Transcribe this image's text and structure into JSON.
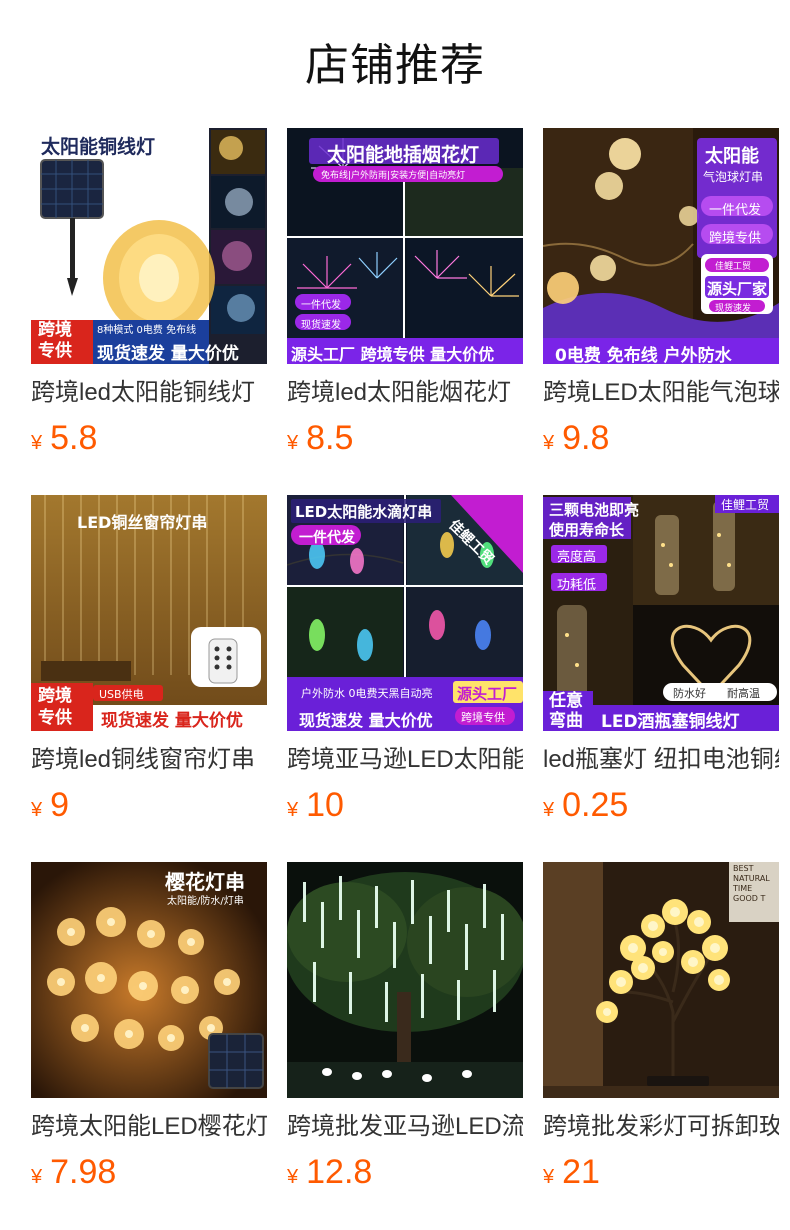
{
  "page": {
    "title": "店铺推荐"
  },
  "currency_symbol": "¥",
  "products": [
    {
      "title": "跨境led太阳能铜线灯",
      "price": "5.8",
      "image_text": {
        "top": "太阳能铜线灯",
        "small": "8种模式 0电费 免布线",
        "badge": "跨境\n专供",
        "bottom": "现货速发 量大价优"
      }
    },
    {
      "title": "跨境led太阳能烟花灯",
      "price": "8.5",
      "image_text": {
        "top": "太阳能地插烟花灯",
        "small": "免布线|户外防雨|安装方便|自动亮灯",
        "tag1": "一件代发",
        "tag2": "现货速发",
        "bottom": "源头工厂 跨境专供 量大价优"
      }
    },
    {
      "title": "跨境LED太阳能气泡球",
      "price": "9.8",
      "image_text": {
        "top": "太阳能",
        "sub": "气泡球灯串",
        "tag1": "一件代发",
        "tag2": "跨境专供",
        "tag3": "佳鲤工贸",
        "tag4": "源头厂家",
        "tag5": "现货速发",
        "bottom": "0电费 免布线 户外防水"
      }
    },
    {
      "title": "跨境led铜线窗帘灯串",
      "price": "9",
      "image_text": {
        "top": "LED铜丝窗帘灯串",
        "badge": "跨境\n专供",
        "small": "USB供电",
        "bottom": "现货速发 量大价优"
      }
    },
    {
      "title": "跨境亚马逊LED太阳能水滴灯串",
      "price": "10",
      "image_text": {
        "top": "LED太阳能水滴灯串",
        "tag1": "一件代发",
        "corner": "佳鲤工贸",
        "small": "户外防水 0电费天黑自动亮",
        "tag2": "源头工厂",
        "bottom": "现货速发 量大价优",
        "tag3": "跨境专供"
      }
    },
    {
      "title": "led瓶塞灯 纽扣电池铜线灯",
      "price": "0.25",
      "image_text": {
        "top1": "三颗电池即亮",
        "top2": "使用寿命长",
        "corner": "佳鲤工贸",
        "tag1": "亮度高",
        "tag2": "功耗低",
        "badge": "任意\n弯曲",
        "small1": "防水好",
        "small2": "耐高温",
        "bottom": "LED酒瓶塞铜线灯"
      }
    },
    {
      "title": "跨境太阳能LED樱花灯串",
      "price": "7.98",
      "image_text": {
        "top": "樱花灯串",
        "small": "太阳能/防水/灯串"
      }
    },
    {
      "title": "跨境批发亚马逊LED流星雨灯",
      "price": "12.8",
      "image_text": {}
    },
    {
      "title": "跨境批发彩灯可拆卸玫瑰树灯",
      "price": "21",
      "image_text": {
        "corner": "BEST\nNATURAL\nTIME\nGOOD T"
      }
    }
  ]
}
